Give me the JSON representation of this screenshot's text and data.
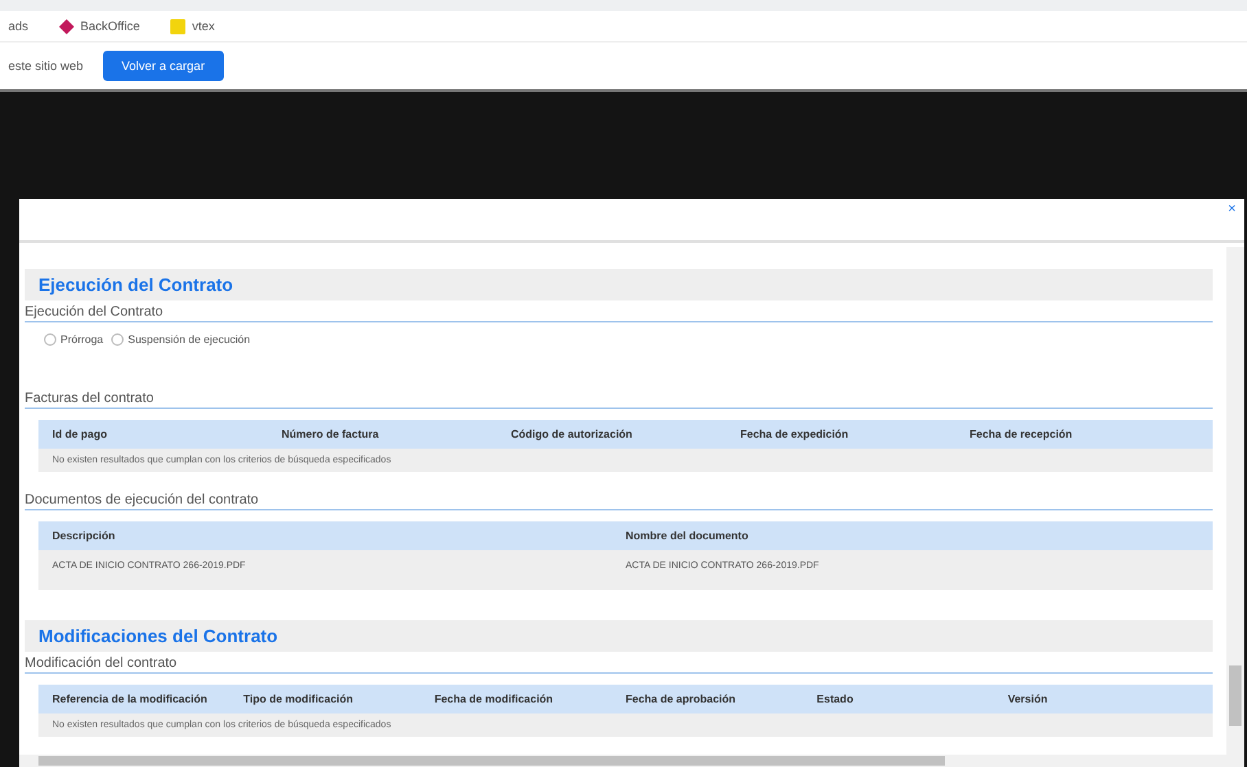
{
  "browser": {
    "bookmarks": [
      {
        "label": "ads",
        "kind": "plain"
      },
      {
        "label": "BackOffice",
        "kind": "diamond"
      },
      {
        "label": "vtex",
        "kind": "square"
      }
    ],
    "notice": "este sitio web",
    "reload_button": "Volver a cargar"
  },
  "modal": {
    "close": "×",
    "sections": [
      {
        "title": "Ejecución del Contrato",
        "blocks": [
          {
            "kind": "radios",
            "subtitle": "Ejecución del Contrato",
            "options": [
              {
                "label": "Prórroga",
                "selected": false
              },
              {
                "label": "Suspensión de ejecución",
                "selected": false
              }
            ]
          },
          {
            "kind": "table",
            "subtitle": "Facturas del contrato",
            "columns": [
              "Id de pago",
              "Número de factura",
              "Código de autorización",
              "Fecha de expedición",
              "Fecha de recepción"
            ],
            "empty": "No existen resultados que cumplan con los criterios de búsqueda especificados"
          },
          {
            "kind": "table",
            "subtitle": "Documentos de ejecución del contrato",
            "columns": [
              "Descripción",
              "Nombre del documento"
            ],
            "rows": [
              [
                "ACTA DE INICIO CONTRATO 266-2019.PDF",
                "ACTA DE INICIO CONTRATO 266-2019.PDF"
              ]
            ]
          }
        ]
      },
      {
        "title": "Modificaciones del Contrato",
        "blocks": [
          {
            "kind": "table",
            "subtitle": "Modificación del contrato",
            "columns": [
              "Referencia de la modificación",
              "Tipo de modificación",
              "Fecha de modificación",
              "Fecha de aprobación",
              "Estado",
              "Versión"
            ],
            "empty": "No existen resultados que cumplan con los criterios de búsqueda especificados"
          }
        ]
      }
    ]
  }
}
